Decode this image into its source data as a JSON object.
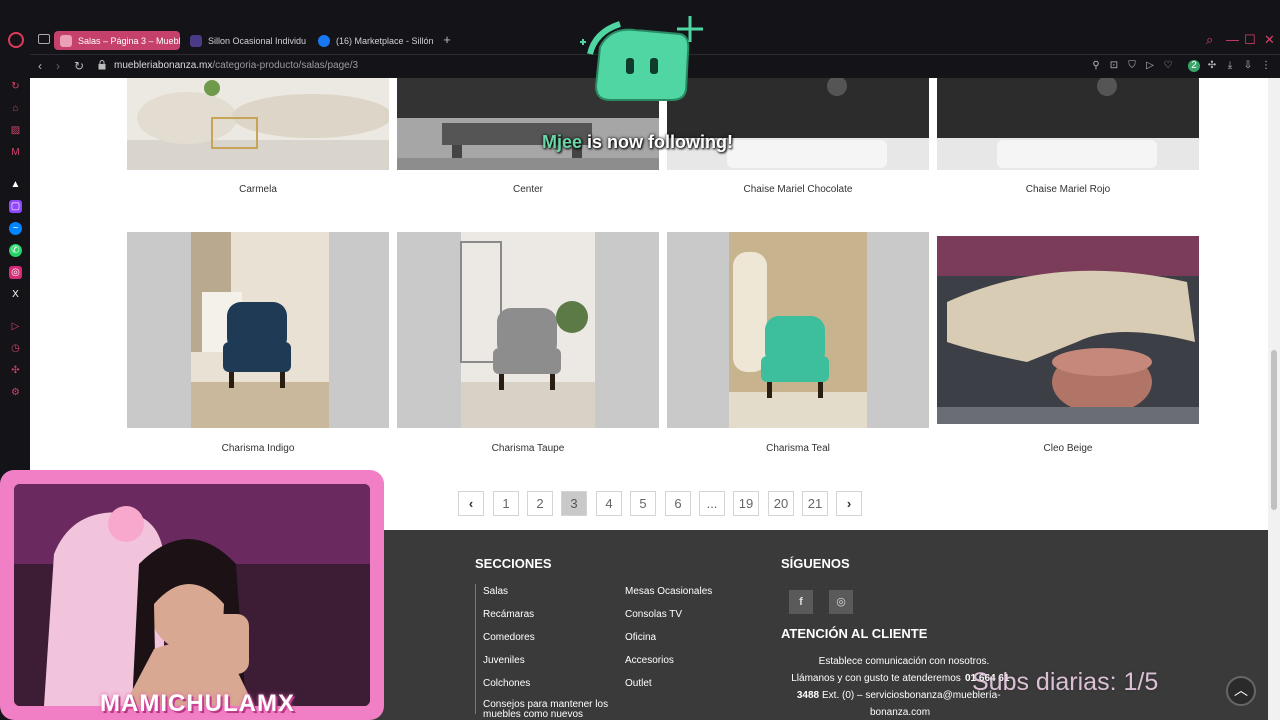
{
  "browser": {
    "tabs": [
      {
        "label": "Salas – Página 3 – Mueble",
        "favicon_color": "#b0b0b0"
      },
      {
        "label": "Sillon Ocasional Individu",
        "favicon_color": "#6a4c93"
      },
      {
        "label": "(16) Marketplace - Sillón",
        "favicon_color": "#1877f2"
      }
    ],
    "url_domain": "muebleriabonanza.mx",
    "url_path": "/categoria-producto/salas/page/3",
    "accent": "#c5416b"
  },
  "products_top": [
    {
      "name": "Carmela"
    },
    {
      "name": "Center"
    },
    {
      "name": "Chaise Mariel Chocolate"
    },
    {
      "name": "Chaise Mariel Rojo"
    }
  ],
  "products_bottom": [
    {
      "name": "Charisma Indigo",
      "chair_color": "#1f3a55"
    },
    {
      "name": "Charisma Taupe",
      "chair_color": "#8d8d8d"
    },
    {
      "name": "Charisma Teal",
      "chair_color": "#3dbf9d"
    },
    {
      "name": "Cleo Beige",
      "chair_color": "#d8cbb4"
    }
  ],
  "pagination": {
    "prev": "‹",
    "next": "›",
    "pages": [
      "1",
      "2",
      "3",
      "4",
      "5",
      "6",
      "...",
      "19",
      "20",
      "21"
    ],
    "current": "3"
  },
  "footer": {
    "secciones_title": "SECCIONES",
    "col1": [
      "Salas",
      "Recámaras",
      "Comedores",
      "Juveniles",
      "Colchones",
      "Consejos para mantener los muebles como nuevos"
    ],
    "col2": [
      "Mesas Ocasionales",
      "Consolas TV",
      "Oficina",
      "Accesorios",
      "Outlet"
    ],
    "siguenos_title": "SÍGUENOS",
    "social": [
      "f",
      "◎"
    ],
    "atencion_title": "ATENCIÓN AL CLIENTE",
    "atencion_line1": "Establece comunicación con nosotros.",
    "atencion_line2": "Llámanos y con gusto te atenderemos",
    "atencion_phone_a": "01 664 61",
    "atencion_phone_b": "3488",
    "atencion_line3": "Ext. (0) – serviciosbonanza@mueblería-",
    "atencion_line4": "bonanza.com"
  },
  "overlays": {
    "follow_user": "Mjee",
    "follow_rest": " is now following!",
    "streamer_name": "MAMICHULAMX",
    "subs_goal": "Subs diarias: 1/5"
  }
}
